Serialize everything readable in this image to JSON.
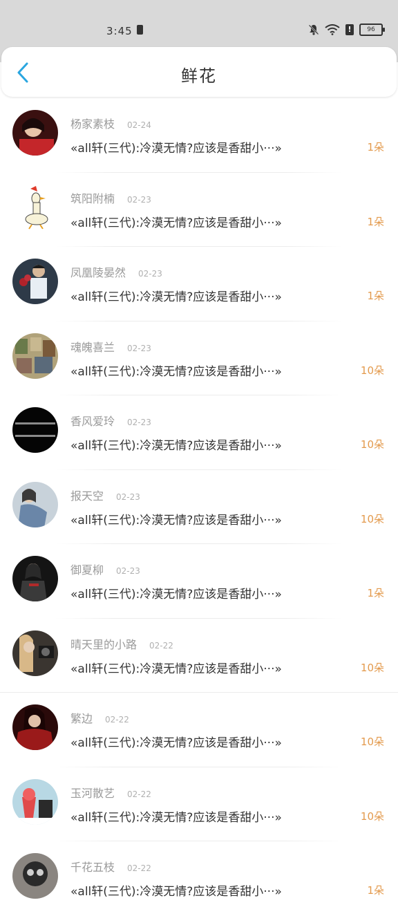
{
  "status_bar": {
    "time": "3:45",
    "battery": "96"
  },
  "header": {
    "title": "鲜花"
  },
  "items": [
    {
      "name": "杨家素枝",
      "date": "02-24",
      "title": "«all轩(三代):冷漠无情?应该是香甜小···»",
      "count": "1朵",
      "avatar_color": "#7a2a2a"
    },
    {
      "name": "筑阳附楠",
      "date": "02-23",
      "title": "«all轩(三代):冷漠无情?应该是香甜小···»",
      "count": "1朵",
      "avatar_color": "#f4f0e0"
    },
    {
      "name": "凤凰陵晏然",
      "date": "02-23",
      "title": "«all轩(三代):冷漠无情?应该是香甜小···»",
      "count": "1朵",
      "avatar_color": "#3d4a5a"
    },
    {
      "name": "魂魄喜兰",
      "date": "02-23",
      "title": "«all轩(三代):冷漠无情?应该是香甜小···»",
      "count": "10朵",
      "avatar_color": "#8a8a6a"
    },
    {
      "name": "香风爱玲",
      "date": "02-23",
      "title": "«all轩(三代):冷漠无情?应该是香甜小···»",
      "count": "10朵",
      "avatar_color": "#0b0b0b"
    },
    {
      "name": "报天空",
      "date": "02-23",
      "title": "«all轩(三代):冷漠无情?应该是香甜小···»",
      "count": "10朵",
      "avatar_color": "#a8b6c2"
    },
    {
      "name": "御夏柳",
      "date": "02-23",
      "title": "«all轩(三代):冷漠无情?应该是香甜小···»",
      "count": "1朵",
      "avatar_color": "#1c1c1c"
    },
    {
      "name": "晴天里的小路",
      "date": "02-22",
      "title": "«all轩(三代):冷漠无情?应该是香甜小···»",
      "count": "10朵",
      "avatar_color": "#4a4038"
    },
    {
      "name": "繁边",
      "date": "02-22",
      "title": "«all轩(三代):冷漠无情?应该是香甜小···»",
      "count": "10朵",
      "avatar_color": "#6a1a1a"
    },
    {
      "name": "玉河散艺",
      "date": "02-22",
      "title": "«all轩(三代):冷漠无情?应该是香甜小···»",
      "count": "10朵",
      "avatar_color": "#c94a4a"
    },
    {
      "name": "千花五枝",
      "date": "02-22",
      "title": "«all轩(三代):冷漠无情?应该是香甜小···»",
      "count": "1朵",
      "avatar_color": "#5a5550"
    }
  ]
}
